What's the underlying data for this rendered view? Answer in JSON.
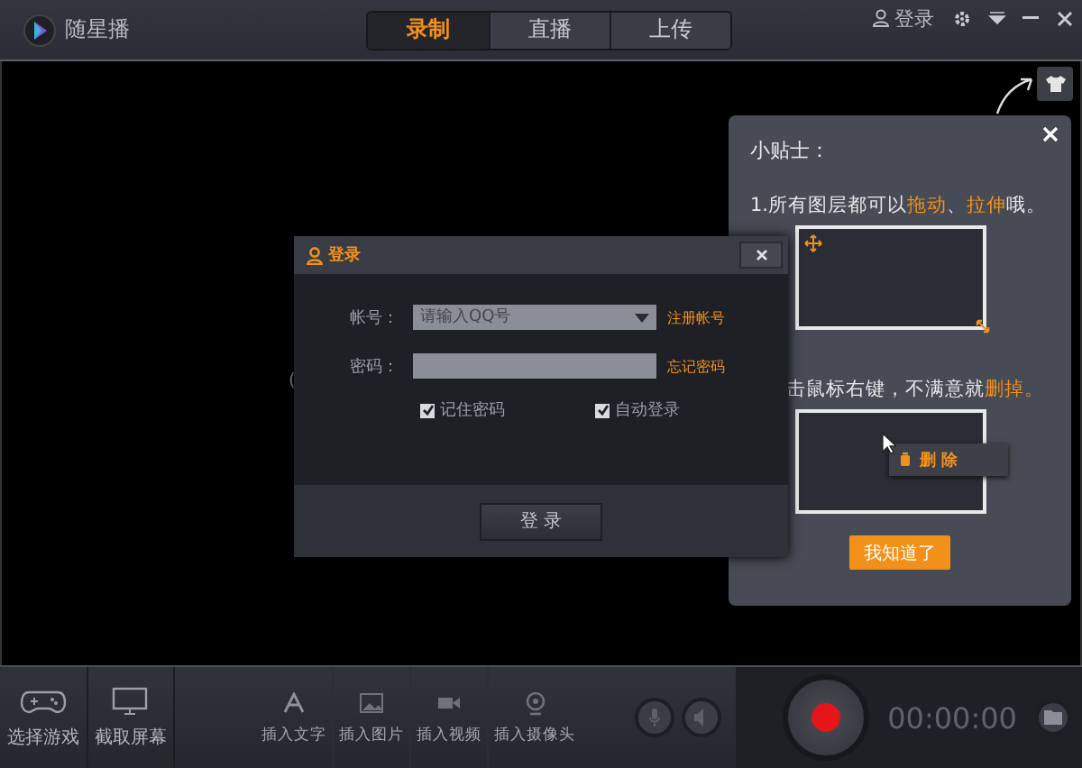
{
  "app": {
    "name": "随星播"
  },
  "tabs": [
    {
      "label": "录制",
      "selected": true
    },
    {
      "label": "直播",
      "selected": false
    },
    {
      "label": "上传",
      "selected": false
    }
  ],
  "top_right": {
    "login": "登录"
  },
  "canvas": {
    "hint_line_2": "("
  },
  "login_dialog": {
    "title": "登录",
    "account_label": "帐号：",
    "account_placeholder": "请输入QQ号",
    "register_link": "注册帐号",
    "password_label": "密码：",
    "forgot_link": "忘记密码",
    "options": [
      {
        "label": "记住密码",
        "checked": true
      },
      {
        "label": "自动登录",
        "checked": true
      }
    ],
    "submit": "登 录"
  },
  "tips": {
    "title": "小贴士：",
    "line_1": [
      {
        "text": "1.所有图层都可以",
        "highlight": false
      },
      {
        "text": "拖动",
        "highlight": true
      },
      {
        "text": "、",
        "highlight": false
      },
      {
        "text": "拉伸",
        "highlight": true
      },
      {
        "text": "哦。",
        "highlight": false
      }
    ],
    "line_2": [
      {
        "text": "击鼠标右键，不满意就",
        "highlight": false
      },
      {
        "text": "删掉。",
        "highlight": true
      }
    ],
    "menu_item": "删 除",
    "confirm": "我知道了"
  },
  "toolbar": {
    "left": [
      {
        "kind": "gamepad",
        "label": "选择游戏"
      },
      {
        "kind": "screen",
        "label": "截取屏幕"
      }
    ],
    "inserts": [
      {
        "kind": "text",
        "label": "插入文字"
      },
      {
        "kind": "image",
        "label": "插入图片"
      },
      {
        "kind": "video",
        "label": "插入视频"
      },
      {
        "kind": "camera",
        "label": "插入摄像头"
      }
    ],
    "timer": "00:00:00"
  }
}
